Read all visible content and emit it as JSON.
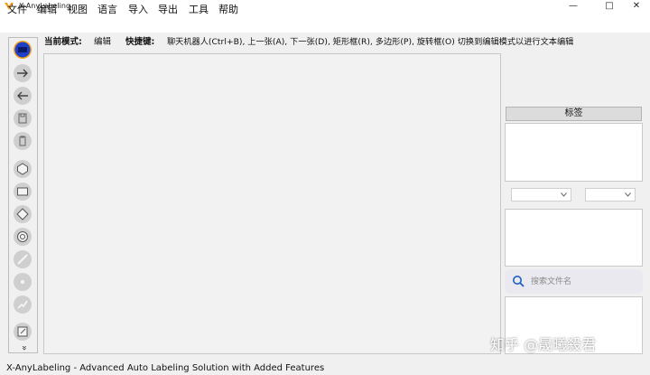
{
  "window": {
    "title": "X-AnyLabeling",
    "minimize": "—",
    "maximize": "□",
    "close": "✕"
  },
  "menu": [
    "文件",
    "编辑",
    "视图",
    "语言",
    "导入",
    "导出",
    "工具",
    "帮助"
  ],
  "info": {
    "mode_label": "当前模式:",
    "mode_value": "编辑",
    "shortcuts_label": "快捷键:",
    "shortcuts_text": "聊天机器人(Ctrl+B), 上一张(A), 下一张(D), 矩形框(R), 多边形(P), 旋转框(O) 切换到编辑模式以进行文本编辑"
  },
  "toolbar": {
    "more": "»",
    "tools": [
      "open-folder-icon",
      "next-image-icon",
      "prev-image-icon",
      "save-icon",
      "delete-icon",
      "polygon-icon",
      "rectangle-icon",
      "rotation-icon",
      "circle-icon",
      "line-icon",
      "point-icon",
      "linestrip-icon",
      "edit-icon"
    ]
  },
  "right_panel": {
    "labels_header": "标签",
    "search_placeholder": "搜索文件名"
  },
  "watermark": "知乎 @晟曦殺君",
  "status": "X-AnyLabeling - Advanced Auto Labeling Solution with Added Features",
  "colors": {
    "accent_blue": "#1f3fc7",
    "accent_orange": "#f6a21a",
    "tool_gray": "#cfcfcf"
  }
}
